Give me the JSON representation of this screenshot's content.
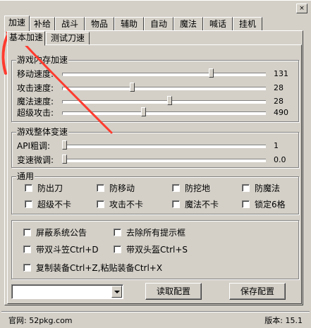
{
  "window": {
    "close_label": "×"
  },
  "main_tabs": [
    "加速",
    "补给",
    "战斗",
    "物品",
    "辅助",
    "自动",
    "魔法",
    "喊话",
    "挂机"
  ],
  "sub_tabs": [
    "基本加速",
    "测试刀速"
  ],
  "speed_group": {
    "title": "游戏内存加速",
    "sliders": [
      {
        "label": "移动速度:",
        "value": "131",
        "position": 0.74
      },
      {
        "label": "攻击速度:",
        "value": "28",
        "position": 0.34
      },
      {
        "label": "魔法速度:",
        "value": "28",
        "position": 0.53
      },
      {
        "label": "超级攻击:",
        "value": "490",
        "position": 0.4
      }
    ]
  },
  "overall_group": {
    "title": "游戏整体变速",
    "sliders": [
      {
        "label": "API粗调:",
        "value": "1",
        "position": 0.0
      },
      {
        "label": "变速微调:",
        "value": "0.0",
        "position": 0.0
      }
    ]
  },
  "general_group": {
    "title": "通用",
    "checkboxes": [
      "防出刀",
      "防移动",
      "防挖地",
      "防魔法",
      "超级不卡",
      "攻击不卡",
      "魔法不卡",
      "锁定6格"
    ]
  },
  "misc_group": {
    "checkboxes": [
      "屏蔽系统公告",
      "去除所有提示框",
      "带双斗笠Ctrl+D",
      "带双头盔Ctrl+S",
      "复制装备Ctrl+Z,粘贴装备Ctrl+X"
    ]
  },
  "config": {
    "combo_value": "",
    "load_label": "读取配置",
    "save_label": "保存配置"
  },
  "status": {
    "site": "官网: 52pkg.com",
    "version": "版本: 15.1"
  },
  "colors": {
    "face": "#d4d0c8",
    "annotation": "#ff3b2f"
  }
}
